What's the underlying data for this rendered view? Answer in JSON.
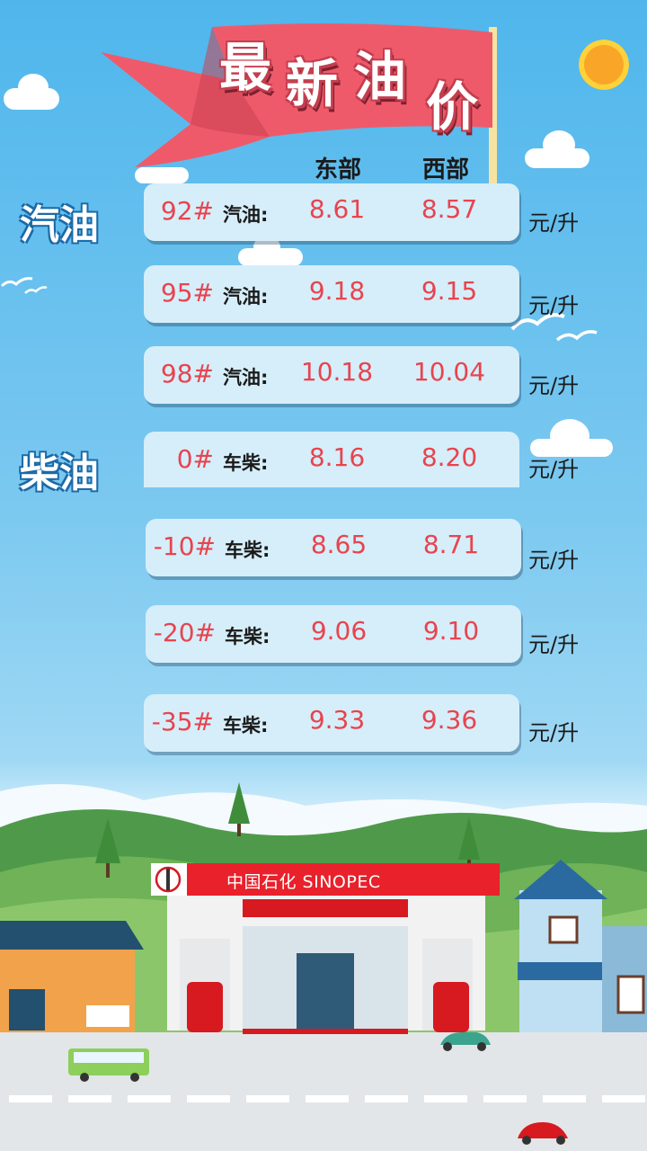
{
  "banner": {
    "chars": [
      "最",
      "新",
      "油",
      "价"
    ]
  },
  "columns": {
    "east": "东部",
    "west": "西部"
  },
  "categories": {
    "gasoline": "汽油",
    "diesel": "柴油"
  },
  "rows": [
    {
      "grade": "92#",
      "type": "汽油:",
      "east": "8.61",
      "west": "8.57",
      "unit": "元/升"
    },
    {
      "grade": "95#",
      "type": "汽油:",
      "east": "9.18",
      "west": "9.15",
      "unit": "元/升"
    },
    {
      "grade": "98#",
      "type": "汽油:",
      "east": "10.18",
      "west": "10.04",
      "unit": "元/升"
    },
    {
      "grade": "0#",
      "type": "车柴:",
      "east": "8.16",
      "west": "8.20",
      "unit": "元/升"
    },
    {
      "grade": "-10#",
      "type": "车柴:",
      "east": "8.65",
      "west": "8.71",
      "unit": "元/升"
    },
    {
      "grade": "-20#",
      "type": "车柴:",
      "east": "9.06",
      "west": "9.10",
      "unit": "元/升"
    },
    {
      "grade": "-35#",
      "type": "车柴:",
      "east": "9.33",
      "west": "9.36",
      "unit": "元/升"
    }
  ],
  "station": {
    "name": "中国石化 SINOPEC"
  },
  "colors": {
    "sky": "#4fb6ec",
    "banner": "#ef5a6b",
    "price": "#e8444f",
    "row_bg": "#d6eef9"
  },
  "icons": {
    "sun": "sun-icon",
    "logo": "sinopec-logo-icon"
  }
}
